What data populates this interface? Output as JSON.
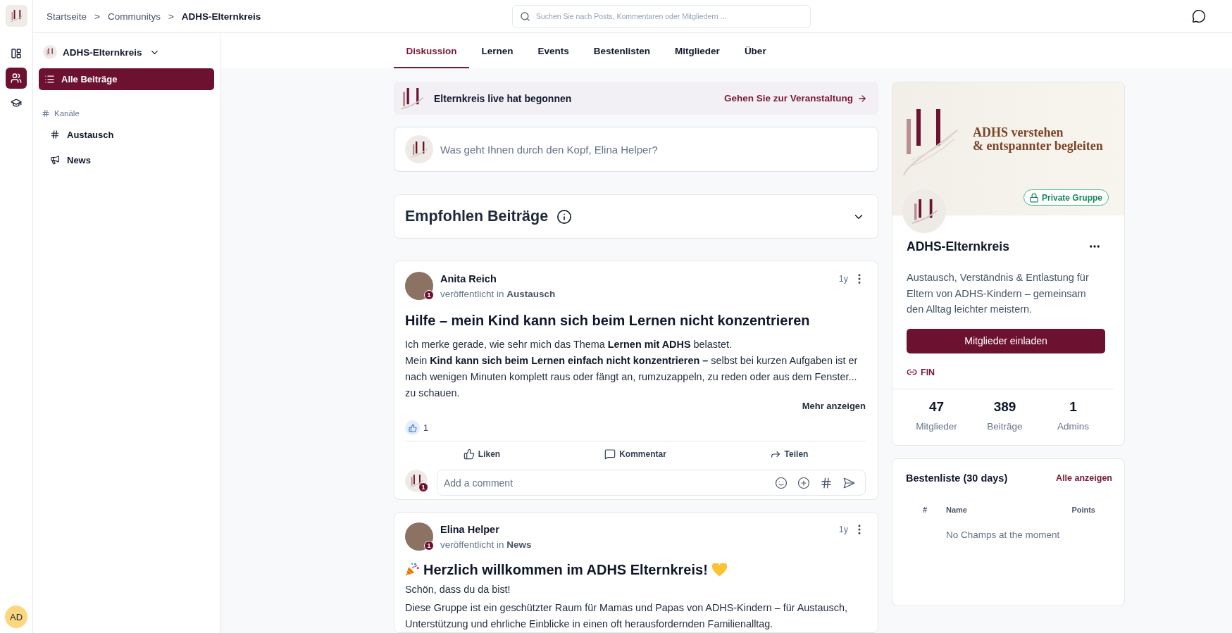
{
  "rail": {
    "items": [
      {
        "kind": "layout",
        "selected": false
      },
      {
        "kind": "community",
        "selected": true
      },
      {
        "kind": "courses",
        "selected": false
      }
    ],
    "user_initials": "AD"
  },
  "header": {
    "breadcrumb": [
      {
        "label": "Startseite",
        "separator": ">",
        "current": false
      },
      {
        "label": "Communitys",
        "separator": ">",
        "current": false
      },
      {
        "label": "ADHS-Elternkreis",
        "current": true
      }
    ],
    "search": {
      "placeholder": "Suchen Sie nach Posts, Kommentaren oder Mitgliedern ..."
    }
  },
  "sidebar": {
    "community": "ADHS-Elternkreis",
    "nav": [
      {
        "label": "Alle Beiträge",
        "selected": true
      }
    ],
    "channels_heading": "Kanäle",
    "channels": [
      {
        "label": "Austausch",
        "kind": "hash",
        "selected": false
      },
      {
        "label": "News",
        "kind": "megaphone",
        "selected": false
      }
    ]
  },
  "tabs": [
    {
      "label": "Diskussion",
      "selected": true
    },
    {
      "label": "Lernen",
      "selected": false
    },
    {
      "label": "Events",
      "selected": false
    },
    {
      "label": "Bestenlisten",
      "selected": false
    },
    {
      "label": "Mitglieder",
      "selected": false
    },
    {
      "label": "Über",
      "selected": false
    }
  ],
  "live_banner": {
    "text": "Elternkreis live hat begonnen",
    "link": "Gehen Sie zur Veranstaltung"
  },
  "composer": {
    "placeholder": "Was geht Ihnen durch den Kopf, Elina Helper?"
  },
  "featured": {
    "title": "Empfohlen Beiträge",
    "expanded": false
  },
  "posts": [
    {
      "kind": "question",
      "author": "Anita Reich",
      "badge": "1",
      "published_in": "veröffentlicht in",
      "channel": "Austausch",
      "age": "1y",
      "title": "Hilfe – mein Kind kann sich beim Lernen nicht konzentrieren",
      "paragraphs": [
        "Ich merke gerade, wie sehr mich das Thema **Lernen mit ADHS** belastet.",
        "Mein **Kind kann sich beim Lernen einfach nicht konzentrieren –** selbst bei kurzen Aufgaben ist er nach wenigen Minuten komplett raus oder fängt an, rumzuzappeln, zu reden oder aus dem Fenster... zu schauen."
      ],
      "more": "Mehr anzeigen",
      "reactions": "1",
      "actions": [
        {
          "kind": "like",
          "label": "Liken"
        },
        {
          "kind": "comment",
          "label": "Kommentar"
        },
        {
          "kind": "share",
          "label": "Teilen"
        }
      ],
      "comment": {
        "placeholder": "Add a comment",
        "badge": "1"
      }
    },
    {
      "kind": "welcome",
      "author": "Elina Helper",
      "badge": "1",
      "published_in": "veröffentlicht in",
      "channel": "News",
      "age": "1y",
      "title": "Herzlich willkommen im ADHS Elternkreis!",
      "paragraphs": [
        "Schön, dass du da bist!",
        "Diese Gruppe ist ein geschützter Raum für Mamas und Papas von ADHS-Kindern – für Austausch, Unterstützung und ehrliche Einblicke in einen oft herausfordernden Familienalltag."
      ]
    }
  ],
  "group": {
    "banner": {
      "lines": [
        "ADHS verstehen",
        "& entspannter begleiten"
      ]
    },
    "privacy": "Private Gruppe",
    "name": "ADHS-Elternkreis",
    "description": "Austausch, Verständnis & Entlastung für Eltern von ADHS-Kindern – gemeinsam den Alltag leichter meistern.",
    "invite_button": "Mitglieder einladen",
    "link": "FIN",
    "stats": [
      {
        "value": "47",
        "label": "Mitglieder"
      },
      {
        "value": "389",
        "label": "Beiträge"
      },
      {
        "value": "1",
        "label": "Admins"
      }
    ]
  },
  "leaderboard": {
    "title": "Bestenliste (30 days)",
    "link": "Alle anzeigen",
    "columns": [
      "#",
      "Name",
      "Points"
    ],
    "empty": "No Champs at the moment"
  }
}
